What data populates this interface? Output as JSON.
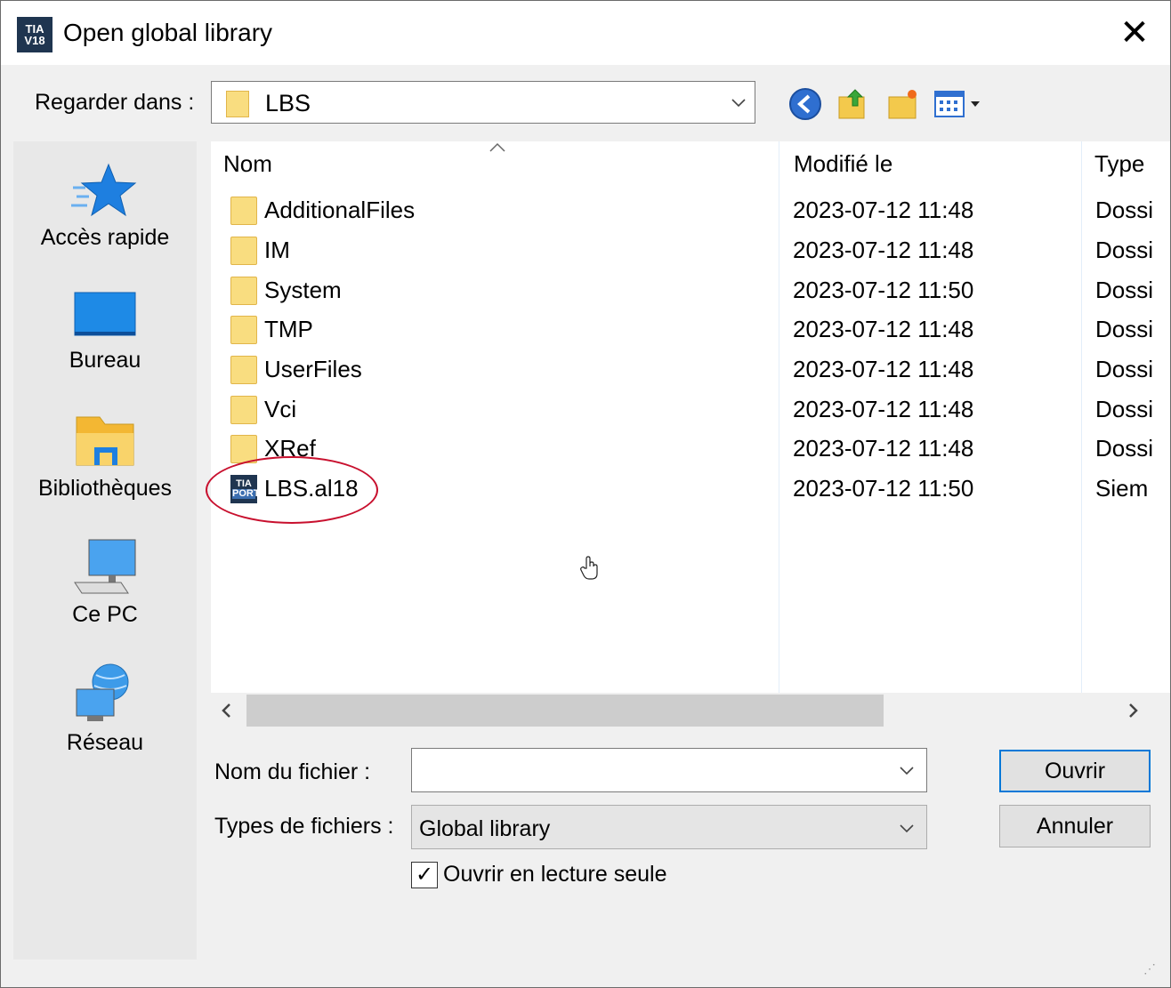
{
  "window": {
    "title": "Open global library",
    "app_icon_top": "TIA",
    "app_icon_bottom": "V18",
    "close_glyph": "✕"
  },
  "look_in": {
    "label": "Regarder dans :",
    "value": "LBS"
  },
  "toolbar": {
    "back_icon": "back-icon",
    "up_icon": "up-folder-icon",
    "new_folder_icon": "new-folder-icon",
    "view_menu_icon": "view-menu-icon"
  },
  "places": [
    {
      "label": "Accès rapide",
      "icon": "star-icon"
    },
    {
      "label": "Bureau",
      "icon": "desktop-icon"
    },
    {
      "label": "Bibliothèques",
      "icon": "libraries-icon"
    },
    {
      "label": "Ce PC",
      "icon": "computer-icon"
    },
    {
      "label": "Réseau",
      "icon": "network-icon"
    }
  ],
  "columns": {
    "name": "Nom",
    "modified": "Modifié le",
    "type": "Type"
  },
  "files": [
    {
      "name": "AdditionalFiles",
      "modified": "2023-07-12 11:48",
      "type": "Dossi",
      "kind": "folder"
    },
    {
      "name": "IM",
      "modified": "2023-07-12 11:48",
      "type": "Dossi",
      "kind": "folder"
    },
    {
      "name": "System",
      "modified": "2023-07-12 11:50",
      "type": "Dossi",
      "kind": "folder"
    },
    {
      "name": "TMP",
      "modified": "2023-07-12 11:48",
      "type": "Dossi",
      "kind": "folder"
    },
    {
      "name": "UserFiles",
      "modified": "2023-07-12 11:48",
      "type": "Dossi",
      "kind": "folder"
    },
    {
      "name": "Vci",
      "modified": "2023-07-12 11:48",
      "type": "Dossi",
      "kind": "folder"
    },
    {
      "name": "XRef",
      "modified": "2023-07-12 11:48",
      "type": "Dossi",
      "kind": "folder"
    },
    {
      "name": "LBS.al18",
      "modified": "2023-07-12 11:50",
      "type": "Siem",
      "kind": "library",
      "icon_top": "TIA",
      "icon_bottom": "PORT"
    }
  ],
  "filename": {
    "label": "Nom du fichier :",
    "value": ""
  },
  "filetype": {
    "label": "Types de fichiers :",
    "value": "Global library"
  },
  "buttons": {
    "open": "Ouvrir",
    "cancel": "Annuler"
  },
  "readonly": {
    "label": "Ouvrir en lecture seule",
    "checked": true,
    "check_glyph": "✓"
  },
  "colors": {
    "accent": "#0078d7",
    "highlight_ring": "#c8102e",
    "folder": "#f9dd80"
  }
}
